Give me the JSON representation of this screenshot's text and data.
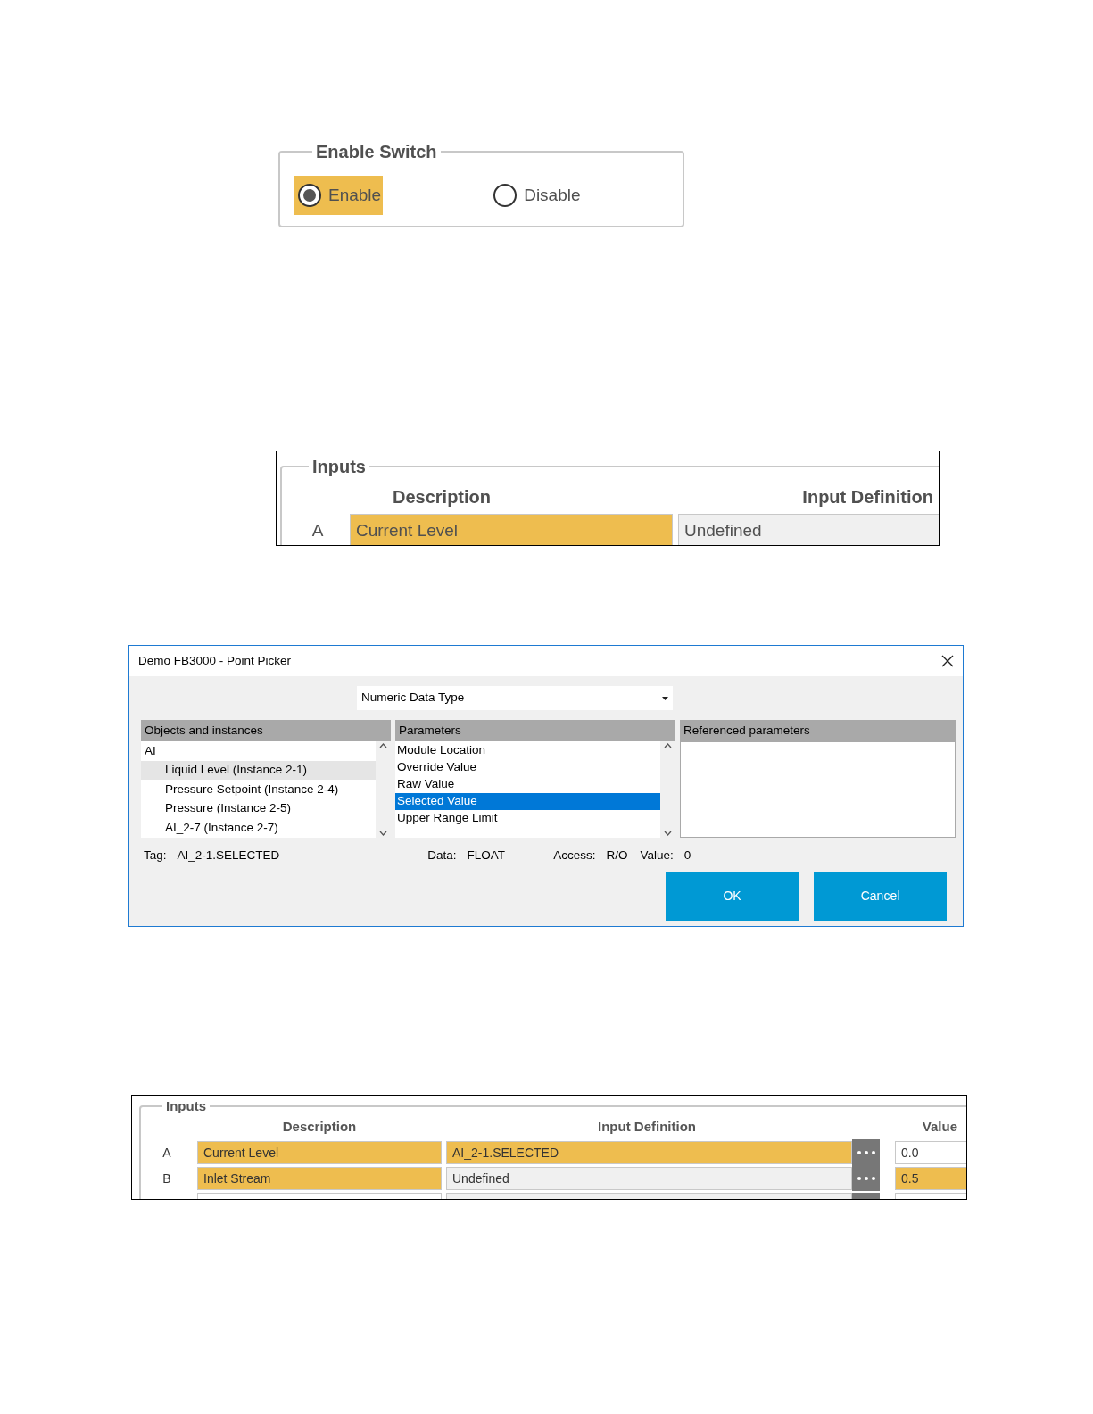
{
  "enable_switch": {
    "title": "Enable Switch",
    "options": [
      {
        "label": "Enable",
        "selected": true,
        "highlighted": true
      },
      {
        "label": "Disable",
        "selected": false,
        "highlighted": false
      }
    ]
  },
  "inputs_panel_1": {
    "title": "Inputs",
    "columns": [
      "Description",
      "Input Definition"
    ],
    "rows": [
      {
        "label": "A",
        "description": {
          "text": "Current Level",
          "highlighted": true
        },
        "definition": {
          "text": "Undefined",
          "highlighted": false
        }
      }
    ]
  },
  "dialog": {
    "title": "Demo FB3000 - Point Picker",
    "data_type": "Numeric Data Type",
    "objects": {
      "header": "Objects and instances",
      "items": [
        {
          "label": "AI_",
          "selected": false,
          "children": [
            {
              "label": "Liquid Level (Instance 2-1)",
              "selected": true
            },
            {
              "label": "Pressure Setpoint (Instance 2-4)",
              "selected": false
            },
            {
              "label": "Pressure (Instance 2-5)",
              "selected": false
            },
            {
              "label": "AI_2-7 (Instance 2-7)",
              "selected": false
            }
          ]
        }
      ]
    },
    "parameters": {
      "header": "Parameters",
      "items": [
        {
          "label": "Module Location",
          "selected": false
        },
        {
          "label": "Override Value",
          "selected": false
        },
        {
          "label": "Raw Value",
          "selected": false
        },
        {
          "label": "Selected Value",
          "selected": true
        },
        {
          "label": "Upper Range Limit",
          "selected": false
        }
      ]
    },
    "referenced": {
      "header": "Referenced parameters"
    },
    "info": [
      {
        "label": "Tag:",
        "value": "AI_2-1.SELECTED"
      },
      {
        "label": "Data:",
        "value": "FLOAT"
      },
      {
        "label": "Access:",
        "value": "R/O"
      },
      {
        "label": "Value:",
        "value": "0"
      }
    ],
    "buttons": [
      "OK",
      "Cancel"
    ]
  },
  "inputs_panel_2": {
    "title": "Inputs",
    "columns": [
      "Description",
      "Input Definition",
      "Value"
    ],
    "rows": [
      {
        "label": "A",
        "description": {
          "text": "Current Level",
          "highlighted": true
        },
        "definition": {
          "text": "AI_2-1.SELECTED",
          "highlighted": true
        },
        "value": {
          "text": "0.0",
          "highlighted": false
        }
      },
      {
        "label": "B",
        "description": {
          "text": "Inlet Stream",
          "highlighted": true
        },
        "definition": {
          "text": "Undefined",
          "highlighted": false
        },
        "value": {
          "text": "0.5",
          "highlighted": true
        }
      }
    ]
  }
}
